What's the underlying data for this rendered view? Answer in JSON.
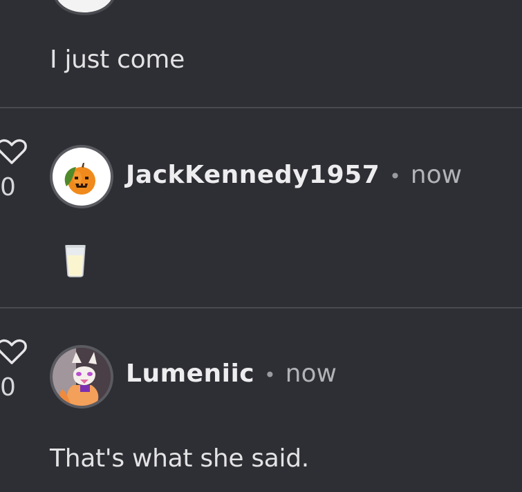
{
  "comments": [
    {
      "text": "I just come"
    },
    {
      "username": "JackKennedy1957",
      "time": "now",
      "likes": "0",
      "content_icon": "milk-glass-emoji",
      "avatar_icon": "jack-o-lantern-orange-icon"
    },
    {
      "username": "Lumeniic",
      "time": "now",
      "likes": "0",
      "text": "That's what she said.",
      "avatar_icon": "fox-animatronic-avatar"
    }
  ],
  "separator": "•",
  "colors": {
    "background": "#2e2f34",
    "divider": "#4a4b50",
    "text": "#e3e3e5",
    "muted": "#b2b3b7"
  }
}
